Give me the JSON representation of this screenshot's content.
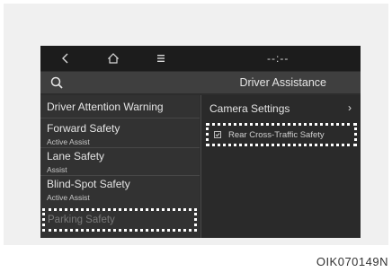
{
  "nav": {
    "back_icon": "chevron-left-icon",
    "home_icon": "home-icon",
    "menu_icon": "menu-icon",
    "clock": "--:--"
  },
  "header": {
    "search_icon": "search-icon",
    "title": "Driver Assistance"
  },
  "left_list": {
    "items": [
      {
        "title": "Driver Attention Warning",
        "subtitle": ""
      },
      {
        "title": "Forward Safety",
        "subtitle": "Active Assist"
      },
      {
        "title": "Lane Safety",
        "subtitle": "Assist"
      },
      {
        "title": "Blind-Spot Safety",
        "subtitle": "Active Assist"
      },
      {
        "title": "Parking Safety",
        "subtitle": ""
      }
    ]
  },
  "right_list": {
    "camera_settings": "Camera Settings",
    "camera_chevron": "›",
    "rear_cross_traffic": {
      "label": "Rear Cross-Traffic Safety",
      "checked": true
    }
  },
  "figure_code": "OIK070149N",
  "colors": {
    "screen_bg": "#2d2d2d",
    "navbar_bg": "#1c1c1c",
    "header_bg": "#3f3f3f",
    "highlight_border": "#ffffff"
  }
}
